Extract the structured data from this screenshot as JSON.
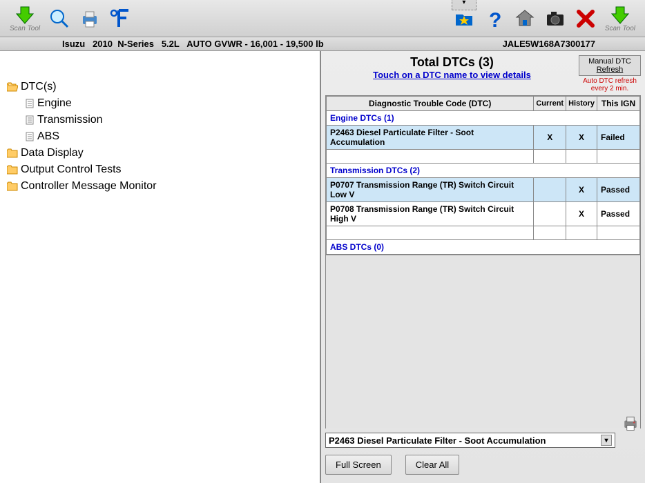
{
  "toolbar": {
    "scan_tool_left": "Scan Tool",
    "scan_tool_right": "Scan Tool"
  },
  "vehicle": {
    "make": "Isuzu",
    "year": "2010",
    "model": "N-Series",
    "engine": "5.2L",
    "trans_gvwr": "AUTO GVWR - 16,001 - 19,500 lb",
    "vin": "JALE5W168A7300177"
  },
  "nav": {
    "dtcs": "DTC(s)",
    "engine": "Engine",
    "transmission": "Transmission",
    "abs": "ABS",
    "data_display": "Data Display",
    "output_control": "Output Control Tests",
    "controller_msg": "Controller Message Monitor"
  },
  "main": {
    "total_label": "Total DTCs (3)",
    "touch_hint": "Touch on a DTC name to view details",
    "refresh_btn_l1": "Manual DTC",
    "refresh_btn_l2": "Refresh",
    "auto_refresh_l1": "Auto DTC refresh",
    "auto_refresh_l2": "every 2 min.",
    "cols": {
      "dtc": "Diagnostic Trouble Code (DTC)",
      "current": "Current",
      "history": "History",
      "this_ign": "This IGN"
    },
    "sections": {
      "engine": "Engine DTCs (1)",
      "transmission": "Transmission DTCs (2)",
      "abs": "ABS DTCs (0)"
    },
    "rows": {
      "r1": {
        "name": "P2463 Diesel Particulate Filter - Soot Accumulation",
        "current": "X",
        "history": "X",
        "ign": "Failed"
      },
      "r2": {
        "name": "P0707 Transmission Range (TR) Switch Circuit Low V",
        "current": "",
        "history": "X",
        "ign": "Passed"
      },
      "r3": {
        "name": "P0708 Transmission Range (TR) Switch Circuit High V",
        "current": "",
        "history": "X",
        "ign": "Passed"
      }
    },
    "selected_dtc": "P2463 Diesel Particulate Filter - Soot Accumulation",
    "full_screen": "Full Screen",
    "clear_all": "Clear All"
  }
}
